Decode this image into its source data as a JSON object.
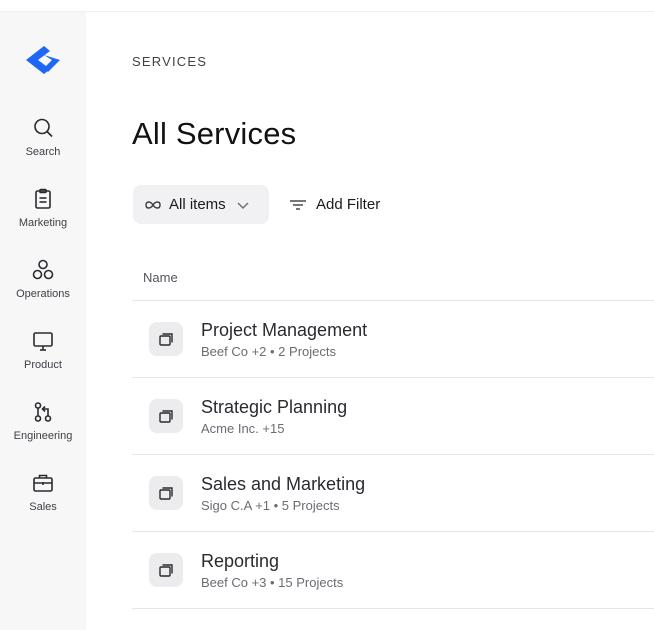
{
  "colors": {
    "brand": "#1e66f5",
    "sidebar_bg": "#f7f7f8",
    "row_badge_bg": "#ececef"
  },
  "sidebar": {
    "logo_icon": "brand-chevron-logo",
    "items": [
      {
        "label": "Search",
        "icon": "search-icon"
      },
      {
        "label": "Marketing",
        "icon": "clipboard-icon"
      },
      {
        "label": "Operations",
        "icon": "operations-icon"
      },
      {
        "label": "Product",
        "icon": "monitor-icon"
      },
      {
        "label": "Engineering",
        "icon": "git-icon"
      },
      {
        "label": "Sales",
        "icon": "briefcase-icon"
      }
    ]
  },
  "main": {
    "breadcrumb": "SERVICES",
    "title": "All Services",
    "filter": {
      "view_label": "All items",
      "add_filter_label": "Add Filter"
    },
    "table": {
      "column_name": "Name",
      "rows": [
        {
          "title": "Project Management",
          "subtitle": "Beef Co +2 • 2 Projects"
        },
        {
          "title": "Strategic Planning",
          "subtitle": "Acme Inc. +15"
        },
        {
          "title": "Sales and Marketing",
          "subtitle": "Sigo C.A +1 • 5 Projects"
        },
        {
          "title": "Reporting",
          "subtitle": "Beef Co +3 • 15 Projects"
        }
      ]
    }
  }
}
